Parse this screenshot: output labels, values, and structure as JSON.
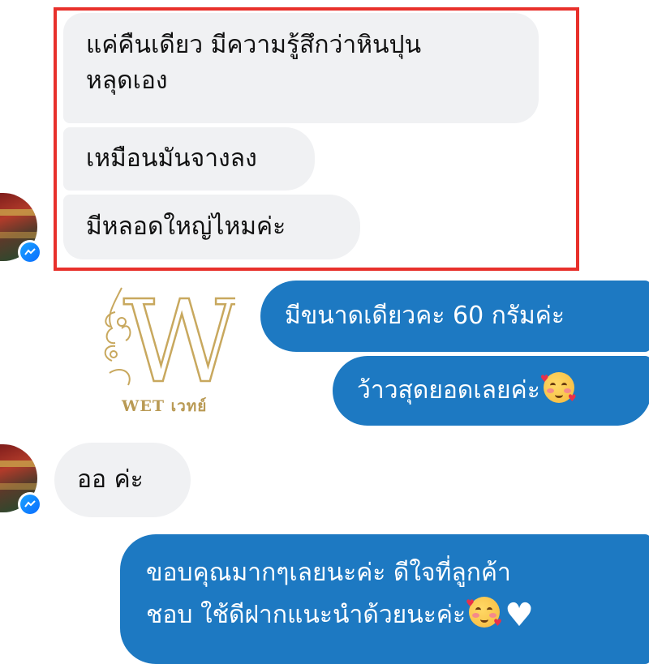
{
  "received_group_1": {
    "messages": [
      "แค่คืนเดียว  มีความรู้สึกว่าหินปุน",
      "หลุดเอง",
      "เหมือนมันจางลง",
      "มีหลอดใหญ่ไหมค่ะ"
    ]
  },
  "sent_group_1": {
    "messages": [
      "มีขนาดเดียวคะ 60 กรัมค่ะ",
      "ว้าวสุดยอดเลยค่ะ"
    ],
    "emoji_icon": "smiling-face-with-hearts-icon"
  },
  "logo": {
    "text": "WET เวทย์",
    "letter": "W"
  },
  "received_group_2": {
    "messages": [
      "ออ  ค่ะ"
    ]
  },
  "sent_group_2": {
    "messages": [
      "ขอบคุณมากๆเลยนะค่ะ ดีใจที่ลูกค้า",
      "ชอบ ใช้ดีฝากแนะนำด้วยนะค่ะ"
    ],
    "emoji_icons": [
      "smiling-face-with-hearts-icon",
      "white-heart-icon"
    ]
  },
  "colors": {
    "sent_bubble": "#1d79c2",
    "received_bubble": "#f0f1f3",
    "highlight_border": "#e8302b",
    "logo_gold": "#b99a54"
  }
}
